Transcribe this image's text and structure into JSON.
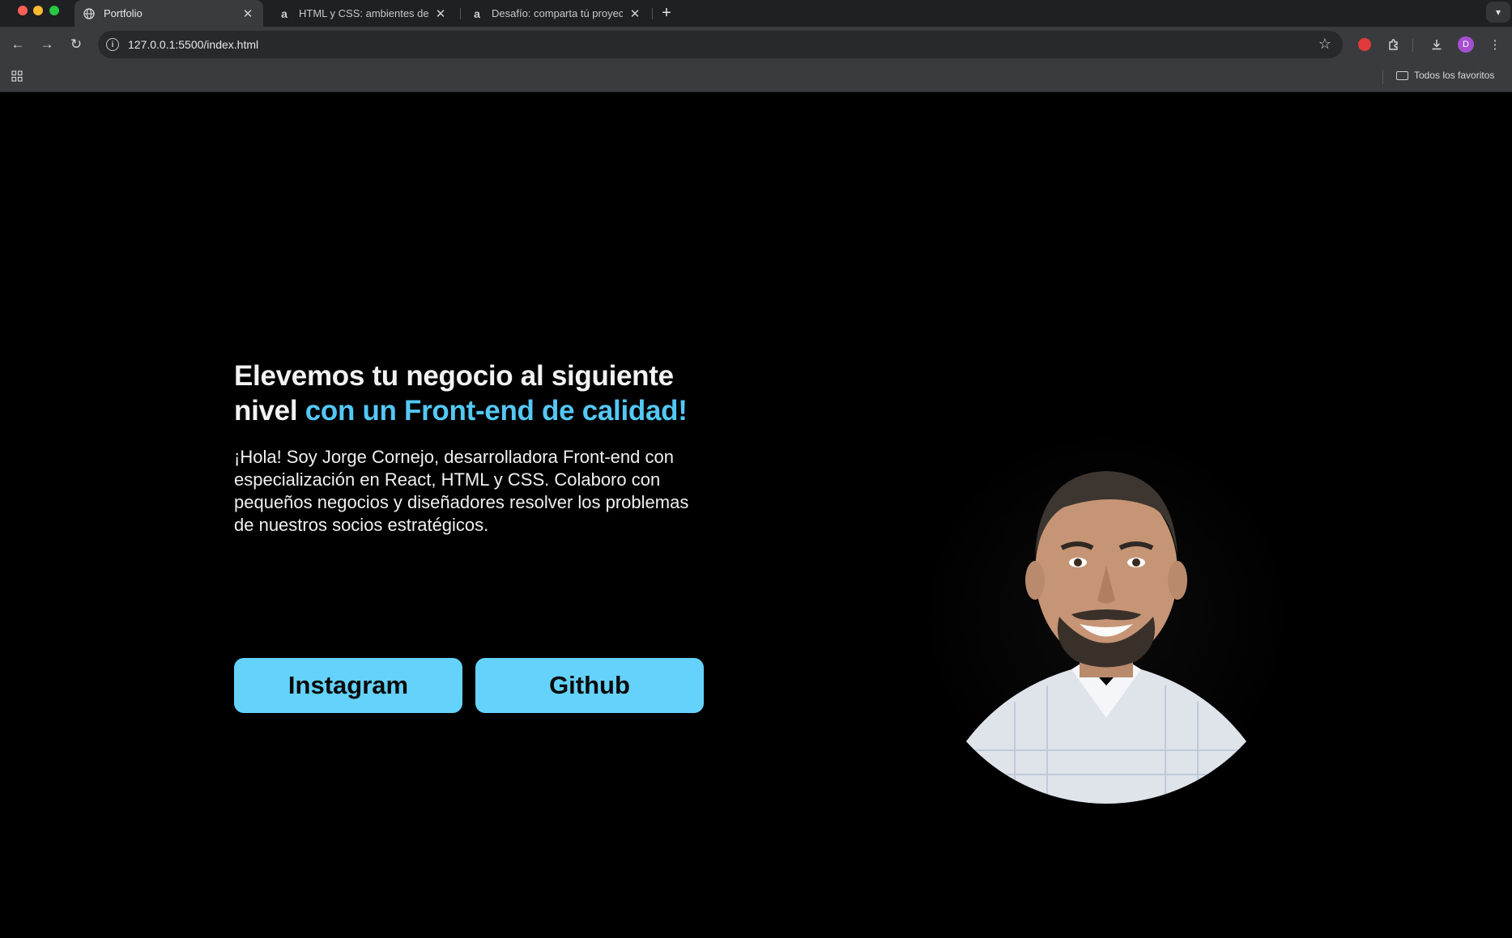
{
  "browser": {
    "tabs": [
      {
        "title": "Portfolio",
        "favicon": "globe-icon",
        "active": true
      },
      {
        "title": "HTML y CSS: ambientes de desarrollo",
        "favicon": "alura-icon",
        "active": false
      },
      {
        "title": "Desafío: comparta tú proyecto",
        "favicon": "alura-icon",
        "active": false
      }
    ],
    "url": "127.0.0.1:5500/index.html",
    "profile_initial": "D",
    "bookmarks_folder": "Todos los favoritos",
    "colors": {
      "tab_strip": "#1f2023",
      "toolbar": "#3a3b3e",
      "omnibox": "#28292c"
    }
  },
  "page": {
    "headline_white": "Elevemos tu negocio al siguiente nivel",
    "headline_accent": "con un Front-end de calidad!",
    "intro": "¡Hola! Soy Jorge Cornejo, desarrolladora Front-end con especialización en React, HTML y CSS. Colaboro con pequeños negocios y diseñadores resolver los problemas de nuestros socios estratégicos.",
    "buttons": {
      "instagram": "Instagram",
      "github": "Github"
    },
    "colors": {
      "background": "#000000",
      "accent": "#54c8f4",
      "button": "#64d2fa"
    }
  }
}
